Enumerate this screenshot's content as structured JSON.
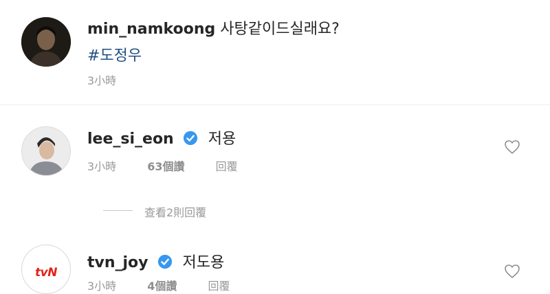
{
  "post": {
    "username": "min_namkoong",
    "caption": "사탕같이드실래요?",
    "hashtag": "#도정우",
    "time": "3小時"
  },
  "comments": [
    {
      "username": "lee_si_eon",
      "verified": true,
      "text": "저용",
      "time": "3小時",
      "likes": "63個讚",
      "reply_label": "回覆",
      "view_replies": "查看2則回覆"
    },
    {
      "username": "tvn_joy",
      "verified": true,
      "avatar_logo": "tvN",
      "text": "저도용",
      "time": "3小時",
      "likes": "4個讚",
      "reply_label": "回覆"
    }
  ],
  "colors": {
    "verified_badge": "#3897f0",
    "hashtag": "#1f4f82",
    "meta_text": "#999999",
    "tvn_red": "#e2231a"
  },
  "icons": [
    "verified-badge-icon",
    "heart-icon"
  ]
}
